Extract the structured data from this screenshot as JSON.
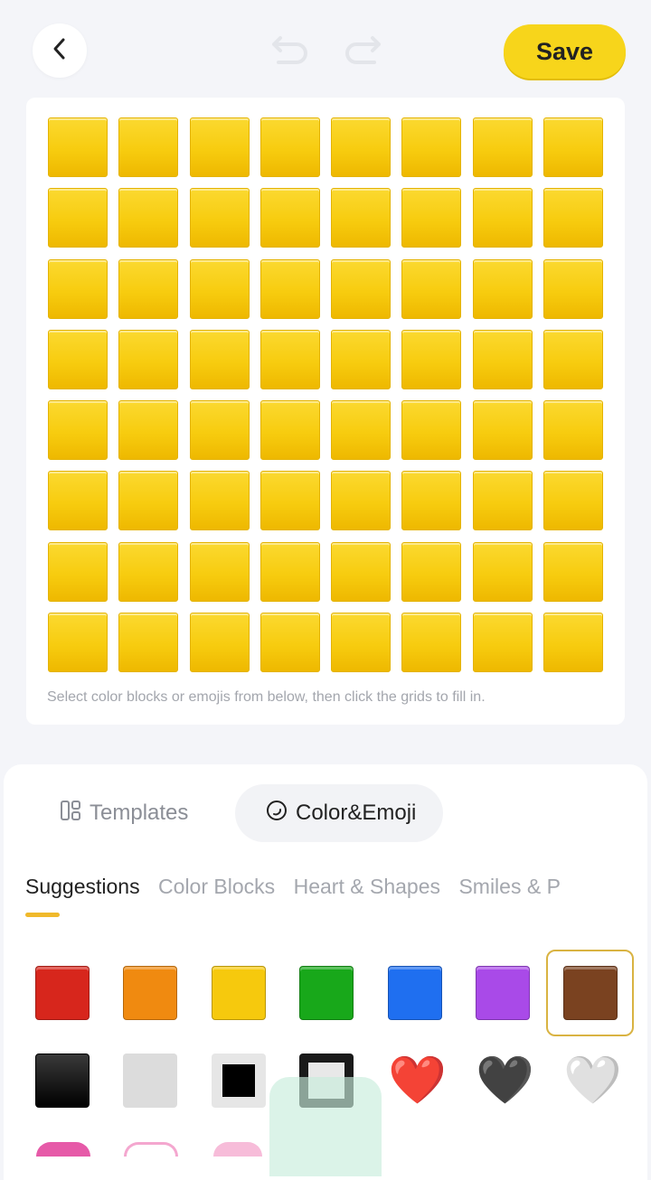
{
  "header": {
    "back_icon": "chevron-left-icon",
    "undo_icon": "undo-icon",
    "redo_icon": "redo-icon",
    "save_label": "Save",
    "save_color": "#f7d51b"
  },
  "canvas": {
    "rows": 8,
    "cols": 8,
    "fill_color": "#f7cc0f",
    "hint": "Select color blocks or emojis from below, then click the grids to fill in."
  },
  "tabs": [
    {
      "label": "Templates",
      "icon": "templates-icon",
      "active": false
    },
    {
      "label": "Color&Emoji",
      "icon": "palette-icon",
      "active": true
    }
  ],
  "categories": [
    {
      "label": "Suggestions",
      "active": true
    },
    {
      "label": "Color Blocks",
      "active": false
    },
    {
      "label": "Heart & Shapes",
      "active": false
    },
    {
      "label": "Smiles & P",
      "active": false
    }
  ],
  "swatches": {
    "row1_colors": [
      "#d7261c",
      "#f08a10",
      "#f6c90d",
      "#18a81a",
      "#1f6ff0",
      "#a94ae8",
      "#7a4220"
    ],
    "selected_index": 6,
    "row2": [
      "black-square",
      "light-gray-square",
      "black-square-on-white",
      "white-square-on-black",
      "red-heart",
      "black-heart",
      "white-heart"
    ],
    "row2_glyphs": [
      "",
      "",
      "",
      "",
      "❤️",
      "🖤",
      "🤍"
    ]
  }
}
